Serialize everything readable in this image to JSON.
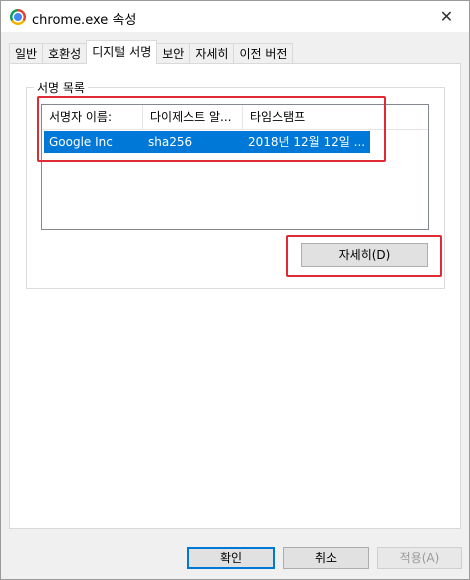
{
  "window": {
    "title": "chrome.exe 속성",
    "close_glyph": "✕"
  },
  "tabs": [
    {
      "label": "일반",
      "active": false
    },
    {
      "label": "호환성",
      "active": false
    },
    {
      "label": "디지털 서명",
      "active": true
    },
    {
      "label": "보안",
      "active": false
    },
    {
      "label": "자세히",
      "active": false
    },
    {
      "label": "이전 버전",
      "active": false
    }
  ],
  "signature_list": {
    "group_label": "서명 목록",
    "columns": [
      "서명자 이름:",
      "다이제스트 알...",
      "타임스탬프"
    ],
    "rows": [
      {
        "signer": "Google Inc",
        "digest": "sha256",
        "timestamp": "2018년 12월 12일 ...",
        "selected": true
      }
    ],
    "details_button": "자세히(D)"
  },
  "footer": {
    "ok": "확인",
    "cancel": "취소",
    "apply": "적용(A)",
    "apply_enabled": false
  },
  "colors": {
    "selection": "#0078d7",
    "annotation_highlight": "#e02a35"
  },
  "icons": {
    "app": "chrome-icon",
    "close": "close-icon"
  }
}
